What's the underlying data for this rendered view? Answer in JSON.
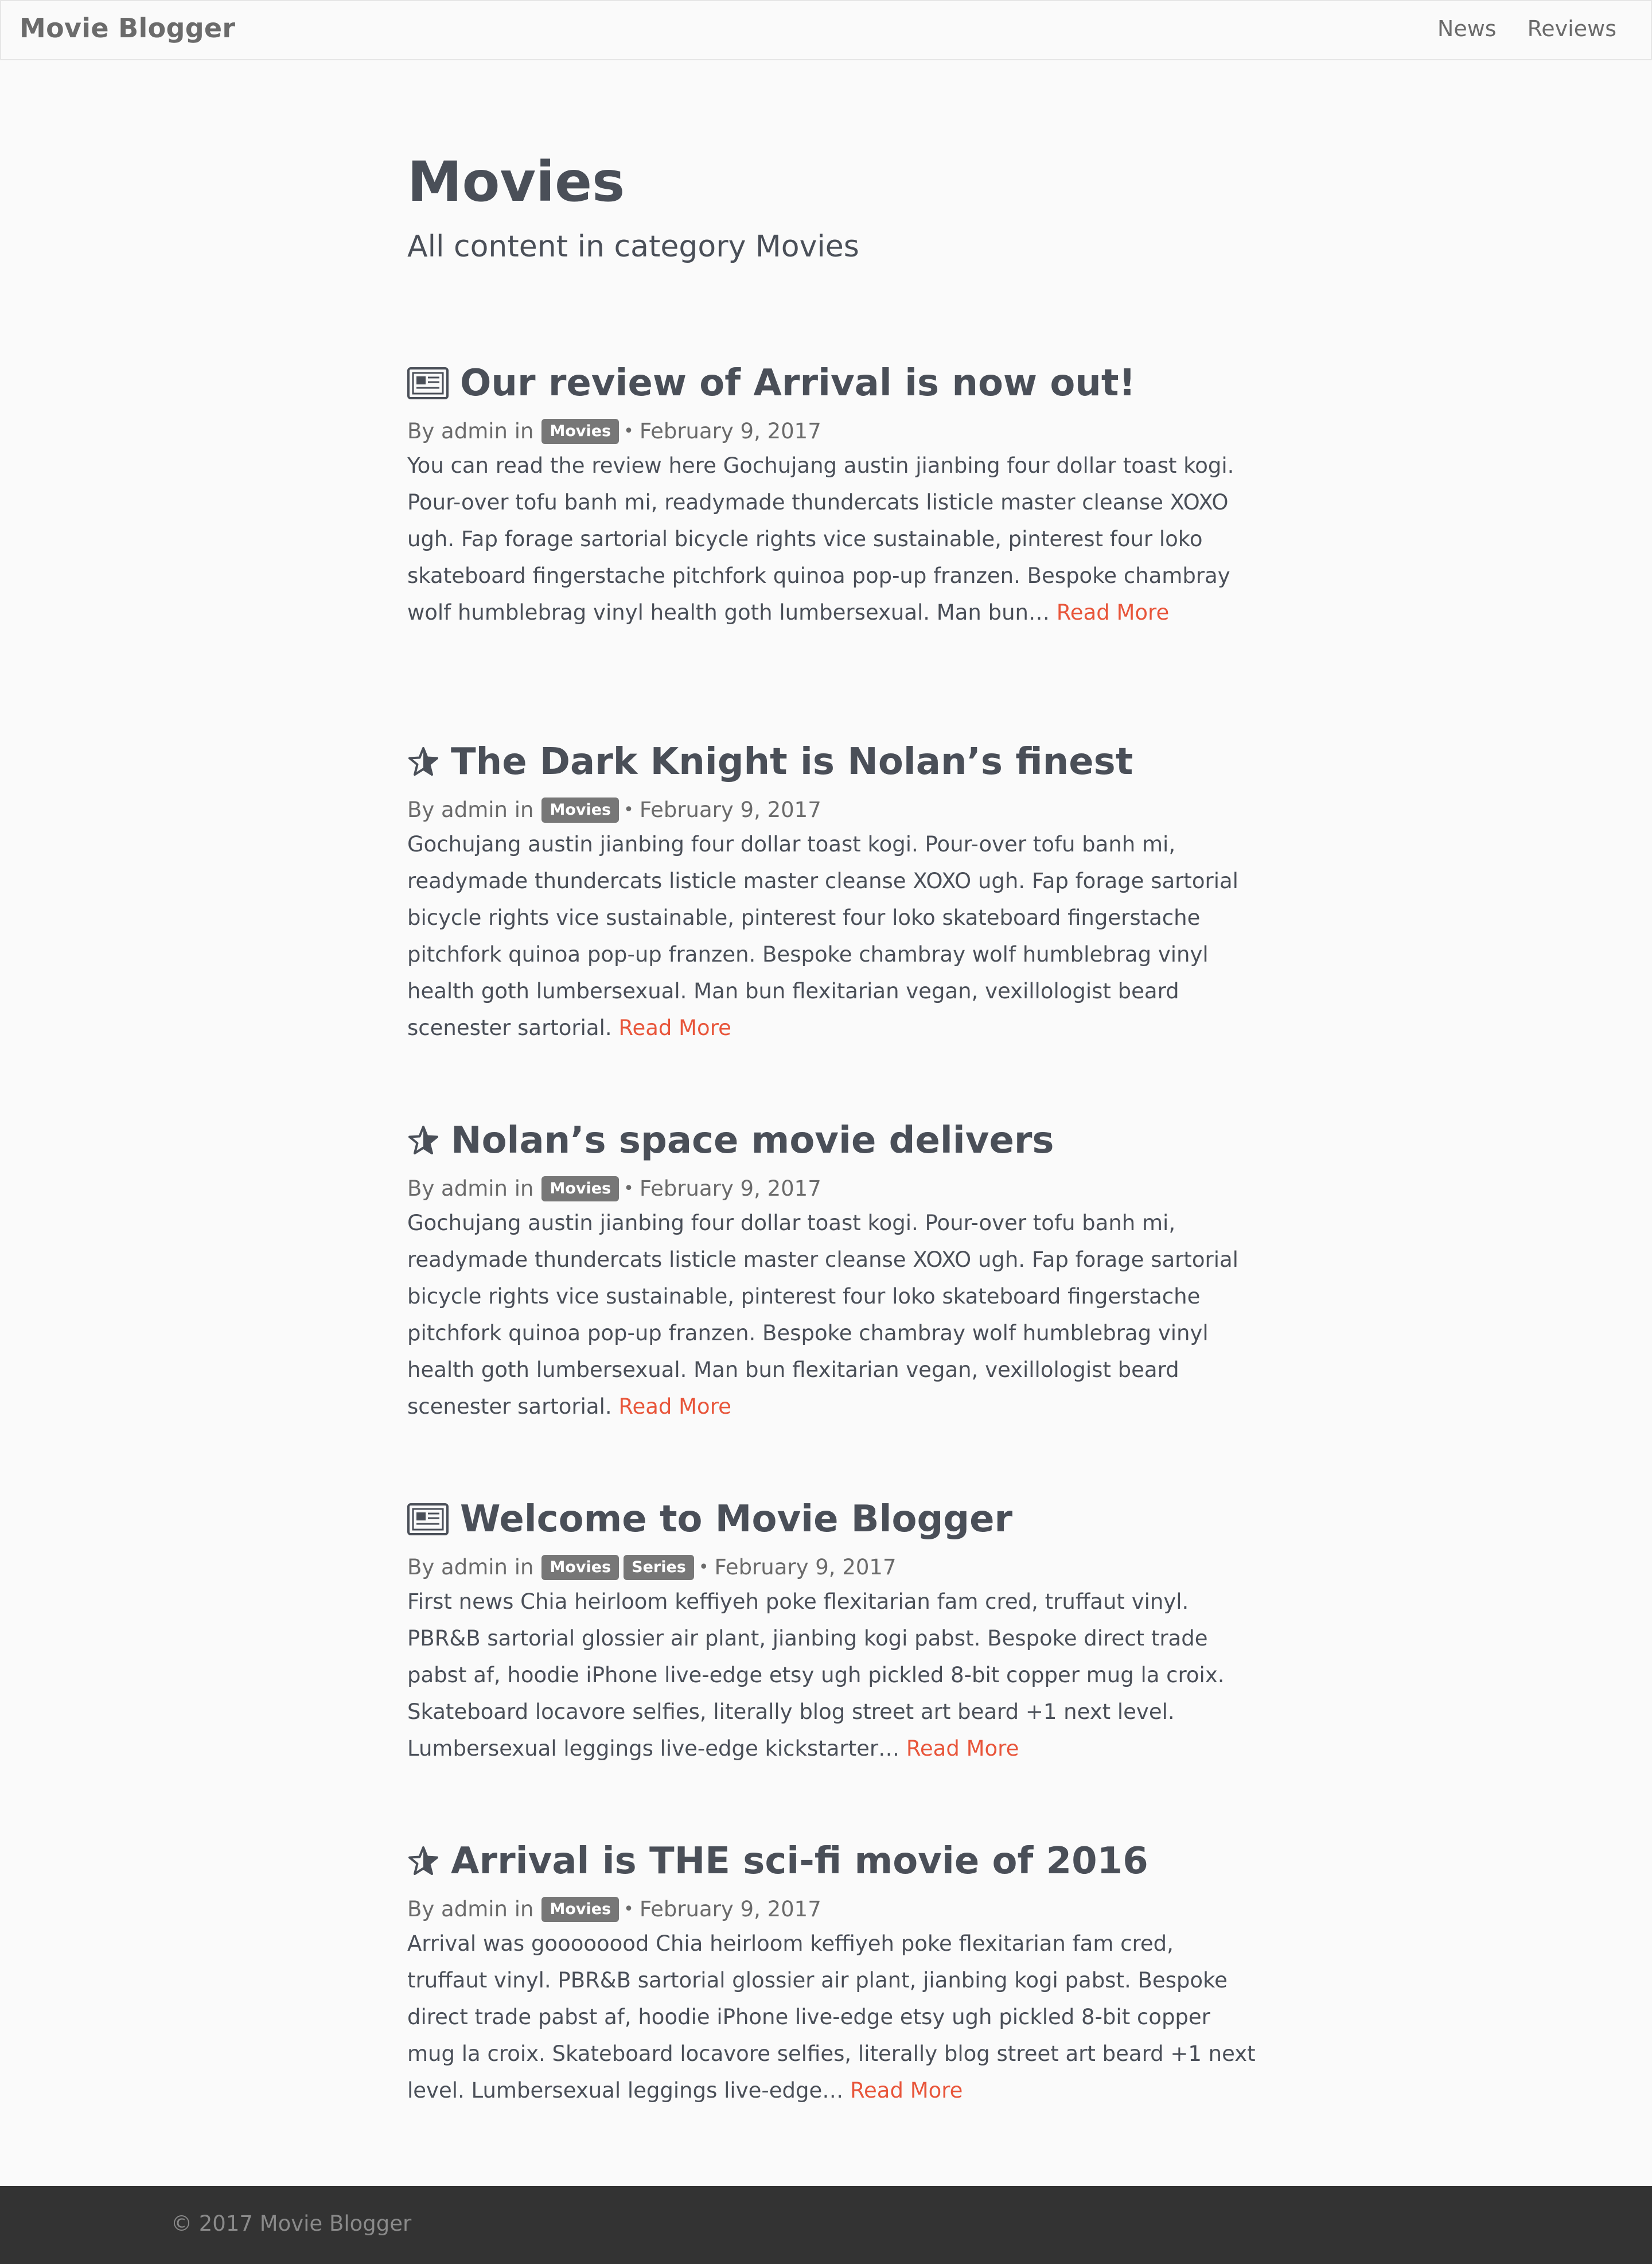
{
  "nav": {
    "brand": "Movie Blogger",
    "links": [
      "News",
      "Reviews"
    ]
  },
  "page": {
    "title": "Movies",
    "subtitle": "All content in category Movies"
  },
  "posts": [
    {
      "icon": "newspaper-icon",
      "title": "Our review of Arrival is now out!",
      "by": "By admin in",
      "tags": [
        "Movies"
      ],
      "date": "February 9, 2017",
      "excerpt": "You can read the review here Gochujang austin jianbing four dollar toast kogi. Pour-over tofu banh mi, readymade thundercats listicle master cleanse XOXO ugh. Fap forage sartorial bicycle rights vice sustainable, pinterest four loko skateboard fingerstache pitchfork quinoa pop-up franzen. Bespoke chambray wolf humblebrag vinyl health goth lumbersexual. Man bun…",
      "read_more": "Read More"
    },
    {
      "icon": "star-icon",
      "title": "The Dark Knight is Nolan’s finest",
      "by": "By admin in",
      "tags": [
        "Movies"
      ],
      "date": "February 9, 2017",
      "excerpt": "Gochujang austin jianbing four dollar toast kogi. Pour-over tofu banh mi, readymade thundercats listicle master cleanse XOXO ugh. Fap forage sartorial bicycle rights vice sustainable, pinterest four loko skateboard fingerstache pitchfork quinoa pop-up franzen. Bespoke chambray wolf humblebrag vinyl health goth lumbersexual. Man bun flexitarian vegan, vexillologist beard scenester sartorial.",
      "read_more": "Read More"
    },
    {
      "icon": "star-icon",
      "title": "Nolan’s space movie delivers",
      "by": "By admin in",
      "tags": [
        "Movies"
      ],
      "date": "February 9, 2017",
      "excerpt": "Gochujang austin jianbing four dollar toast kogi. Pour-over tofu banh mi, readymade thundercats listicle master cleanse XOXO ugh. Fap forage sartorial bicycle rights vice sustainable, pinterest four loko skateboard fingerstache pitchfork quinoa pop-up franzen. Bespoke chambray wolf humblebrag vinyl health goth lumbersexual. Man bun flexitarian vegan, vexillologist beard scenester sartorial.",
      "read_more": "Read More"
    },
    {
      "icon": "newspaper-icon",
      "title": "Welcome to Movie Blogger",
      "by": "By admin in",
      "tags": [
        "Movies",
        "Series"
      ],
      "date": "February 9, 2017",
      "excerpt": "First news Chia heirloom keffiyeh poke flexitarian fam cred, truffaut vinyl. PBR&B sartorial glossier air plant, jianbing kogi pabst. Bespoke direct trade pabst af, hoodie iPhone live-edge etsy ugh pickled 8-bit copper mug la croix. Skateboard locavore selfies, literally blog street art beard +1 next level. Lumbersexual leggings live-edge kickstarter…",
      "read_more": "Read More"
    },
    {
      "icon": "star-icon",
      "title": "Arrival is THE sci-fi movie of 2016",
      "by": "By admin in",
      "tags": [
        "Movies"
      ],
      "date": "February 9, 2017",
      "excerpt": "Arrival was goooooood Chia heirloom keffiyeh poke flexitarian fam cred, truffaut vinyl. PBR&B sartorial glossier air plant, jianbing kogi pabst. Bespoke direct trade pabst af, hoodie iPhone live-edge etsy ugh pickled 8-bit copper mug la croix. Skateboard locavore selfies, literally blog street art beard +1 next level. Lumbersexual leggings live-edge…",
      "read_more": "Read More"
    }
  ],
  "footer": {
    "text": "© 2017 Movie Blogger"
  },
  "colors": {
    "accent": "#e8553a",
    "tag_bg": "#777777",
    "footer_bg": "#333333"
  }
}
